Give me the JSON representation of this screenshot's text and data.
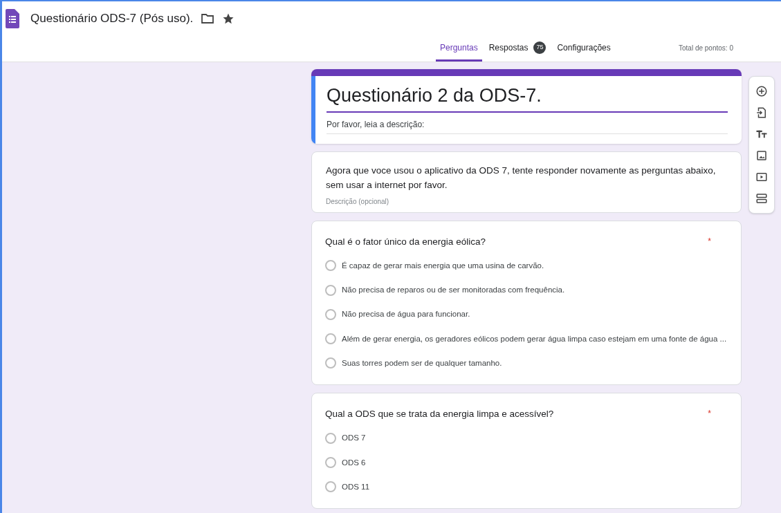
{
  "window": {
    "title": "Questionário ODS-7 (Pós uso)."
  },
  "tabs": [
    {
      "label": "Perguntas",
      "selected": true
    },
    {
      "label": "Respostas",
      "selected": false,
      "badge": "75"
    },
    {
      "label": "Configurações",
      "selected": false
    }
  ],
  "total_points": "Total de pontos: 0",
  "form_header": {
    "title": "Questionário 2 da ODS-7.",
    "description": "Por favor, leia a descrição:"
  },
  "section": {
    "text": "Agora que voce usou o aplicativo da ODS 7, tente responder novamente as perguntas abaixo, sem usar a internet por favor.",
    "placeholder": "Descrição (opcional)"
  },
  "questions": [
    {
      "title": "Qual é o fator único da energia eólica?",
      "required_mark": "*",
      "options": [
        {
          "label": "É capaz de gerar mais energia que uma usina de carvão.",
          "selected": false
        },
        {
          "label": "Não precisa de reparos ou de ser monitoradas com frequência.",
          "selected": false
        },
        {
          "label": "Não precisa de água para funcionar.",
          "selected": false
        },
        {
          "label": "Além de gerar energia, os geradores eólicos podem gerar água limpa caso estejam em uma fonte de água ...",
          "selected": false
        },
        {
          "label": "Suas torres podem ser de qualquer tamanho.",
          "selected": false
        }
      ]
    },
    {
      "title": "Qual a ODS que se trata da energia limpa e acessível?",
      "required_mark": "*",
      "options": [
        {
          "label": "ODS 7",
          "selected": false
        },
        {
          "label": "ODS 6",
          "selected": false
        },
        {
          "label": "ODS 11",
          "selected": false
        }
      ]
    }
  ]
}
